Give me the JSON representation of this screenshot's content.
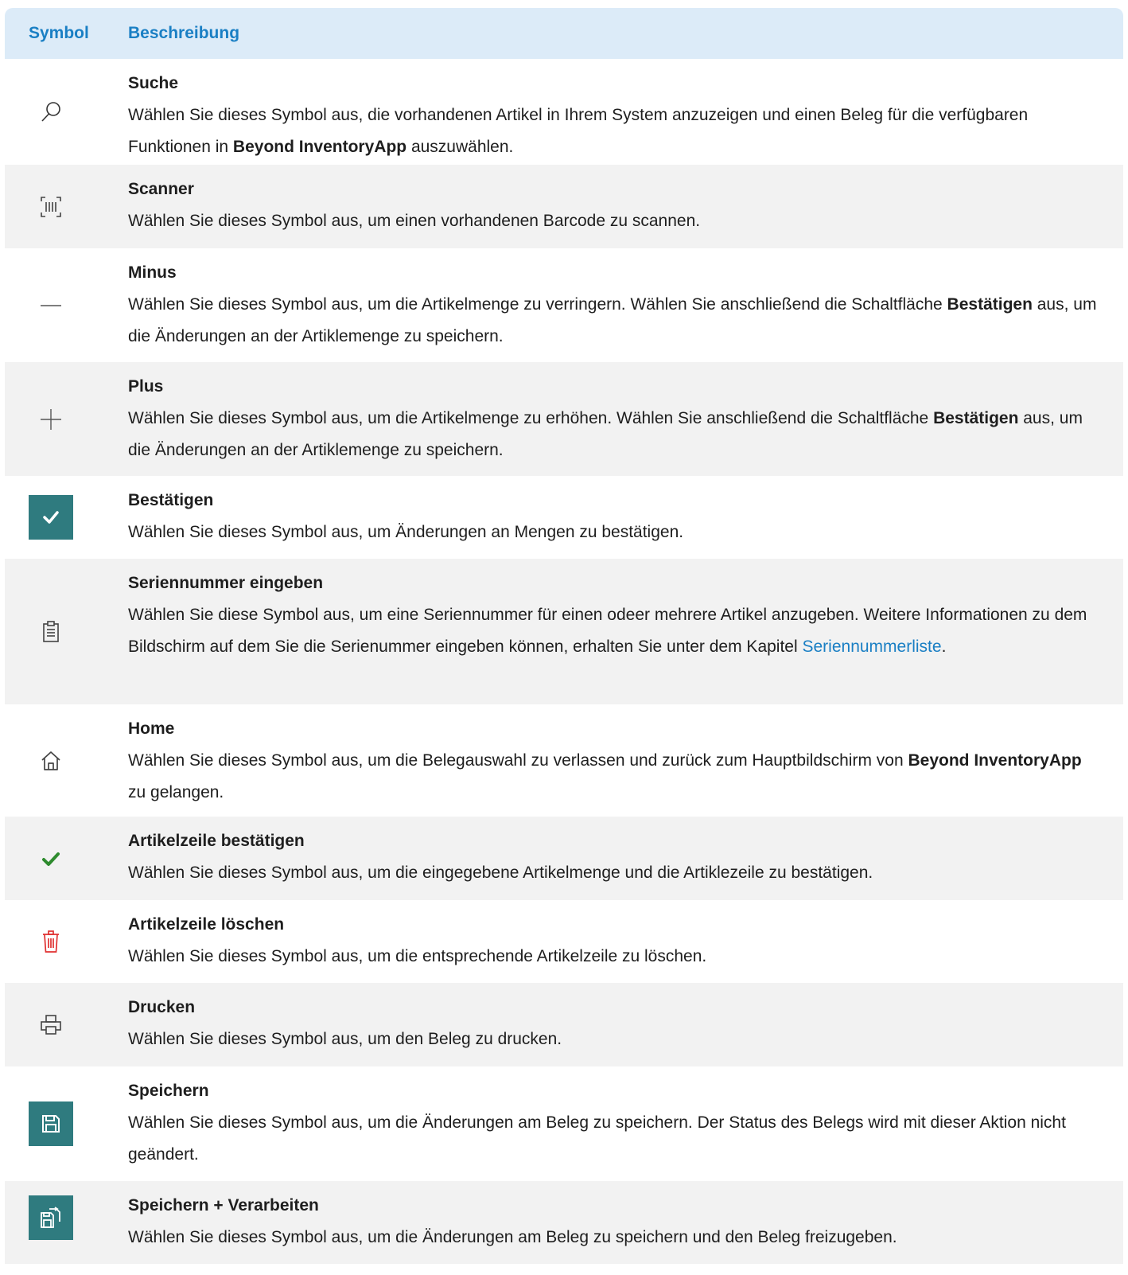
{
  "header": {
    "col_symbol": "Symbol",
    "col_description": "Beschreibung"
  },
  "rows": [
    {
      "icon": "search-icon",
      "title": "Suche",
      "d1": "Wählen Sie dieses Symbol aus, die vorhandenen Artikel in Ihrem System anzuzeigen und einen Beleg für die verfügbaren Funktionen in ",
      "b1": "Beyond InventoryApp",
      "d2": " auszuwählen."
    },
    {
      "icon": "barcode-scanner-icon",
      "title": "Scanner",
      "d1": "Wählen Sie dieses Symbol aus, um einen vorhandenen Barcode zu scannen."
    },
    {
      "icon": "minus-icon",
      "title": "Minus",
      "d1": "Wählen Sie dieses Symbol aus, um die Artikelmenge zu verringern. Wählen Sie anschließend die Schaltfläche ",
      "b1": "Bestätigen",
      "d2": " aus, um die Änderungen an der Artiklemenge zu speichern."
    },
    {
      "icon": "plus-icon",
      "title": "Plus",
      "d1": "Wählen Sie dieses Symbol aus, um die Artikelmenge zu erhöhen. Wählen Sie anschließend die Schaltfläche ",
      "b1": "Bestätigen",
      "d2": " aus, um die Änderungen an der Artiklemenge zu speichern."
    },
    {
      "icon": "confirm-check-icon",
      "title": "Bestätigen",
      "d1": "Wählen Sie dieses Symbol aus, um Änderungen an Mengen zu bestätigen."
    },
    {
      "icon": "clipboard-list-icon",
      "title": "Seriennummer eingeben",
      "d1": "Wählen Sie diese Symbol aus, um eine Seriennummer für einen odeer mehrere Artikel anzugeben. Weitere Informationen zu dem Bildschirm auf dem Sie die Serienummer eingeben können, erhalten Sie unter dem Kapitel ",
      "link": "Seriennummerliste",
      "d2": "."
    },
    {
      "icon": "home-icon",
      "title": "Home",
      "d1": "Wählen Sie dieses Symbol aus, um die Belegauswahl zu verlassen und zurück zum Hauptbildschirm von ",
      "b1": "Beyond InventoryApp",
      "d2": " zu gelangen."
    },
    {
      "icon": "green-check-icon",
      "title": "Artikelzeile bestätigen",
      "d1": "Wählen Sie dieses Symbol aus, um die eingegebene Artikelmenge und die Artiklezeile zu bestätigen."
    },
    {
      "icon": "trash-icon",
      "title": "Artikelzeile löschen",
      "d1": "Wählen Sie dieses Symbol aus, um die entsprechende Artikelzeile zu löschen."
    },
    {
      "icon": "printer-icon",
      "title": "Drucken",
      "d1": "Wählen Sie dieses Symbol aus, um den Beleg zu drucken."
    },
    {
      "icon": "save-icon",
      "title": "Speichern",
      "d1": "Wählen Sie dieses Symbol aus, um die Änderungen am Beleg zu speichern. Der Status des Belegs wird mit dieser Aktion nicht geändert."
    },
    {
      "icon": "save-process-icon",
      "title": "Speichern + Verarbeiten",
      "d1": "Wählen Sie dieses Symbol aus, um die Änderungen am Beleg zu speichern und den Beleg freizugeben."
    }
  ],
  "colors": {
    "accent": "#1a7fc4",
    "header_bg": "#dcebf8",
    "teal": "#2f7b7f",
    "check_green": "#2e8b2e",
    "trash_red": "#e03030"
  }
}
